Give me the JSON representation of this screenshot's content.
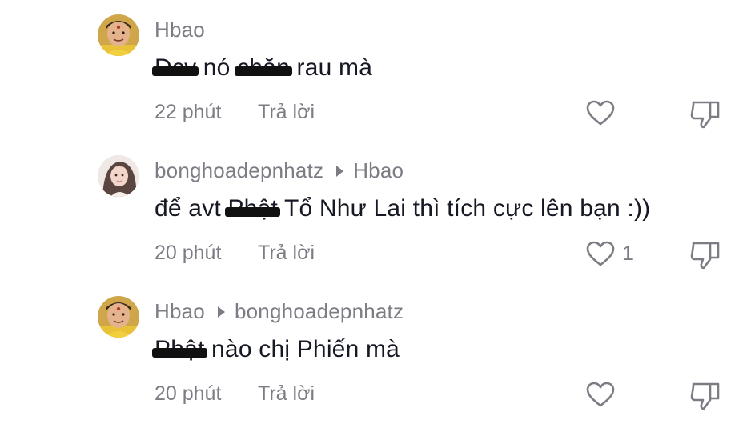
{
  "comments": [
    {
      "username": "Hbao",
      "reply_to": "",
      "text_parts": [
        {
          "text": "Đcv",
          "redacted": true
        },
        {
          "text": " nó ",
          "redacted": false
        },
        {
          "text": "chăn",
          "redacted": true
        },
        {
          "text": " rau mà",
          "redacted": false
        }
      ],
      "time": "22 phút",
      "reply_label": "Trả lời",
      "like_count": "",
      "like_icon": "heart-outline-icon",
      "dislike_icon": "thumbs-down-outline-icon"
    },
    {
      "username": "bonghoadepnhatz",
      "reply_to": "Hbao",
      "text_parts": [
        {
          "text": "để avt ",
          "redacted": false
        },
        {
          "text": "Phật",
          "redacted": true
        },
        {
          "text": " Tổ Như Lai thì tích cực lên bạn :))",
          "redacted": false
        }
      ],
      "time": "20 phút",
      "reply_label": "Trả lời",
      "like_count": "1",
      "like_icon": "heart-outline-icon",
      "dislike_icon": "thumbs-down-outline-icon"
    },
    {
      "username": "Hbao",
      "reply_to": "bonghoadepnhatz",
      "text_parts": [
        {
          "text": "Phật",
          "redacted": true
        },
        {
          "text": " nào chị Phiến mà",
          "redacted": false
        }
      ],
      "time": "20 phút",
      "reply_label": "Trả lời",
      "like_count": "",
      "like_icon": "heart-outline-icon",
      "dislike_icon": "thumbs-down-outline-icon"
    }
  ],
  "colors": {
    "text_primary": "#161823",
    "text_secondary": "#7c7d84",
    "icon": "#7c7d84",
    "redaction": "#111111"
  }
}
